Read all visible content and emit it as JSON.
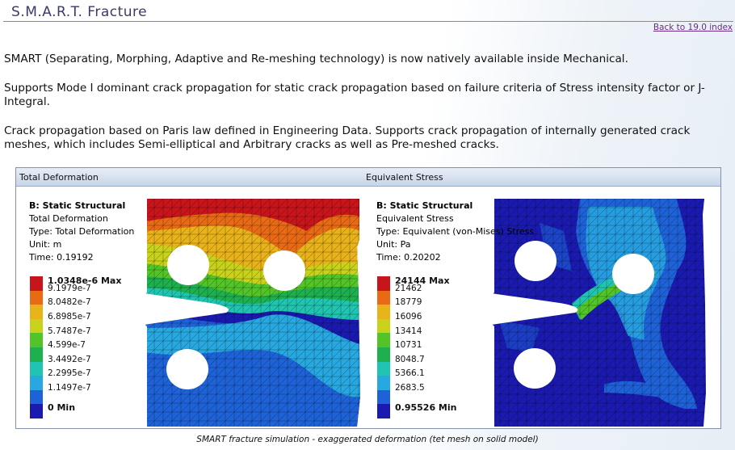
{
  "page": {
    "title": "S.M.A.R.T. Fracture",
    "back_link": "Back to 19.0 index"
  },
  "paragraphs": [
    "SMART (Separating, Morphing, Adaptive and Re-meshing technology) is now natively available inside Mechanical.",
    "Supports Mode I dominant crack propagation for static crack propagation based on failure criteria of Stress intensity factor or J-Integral.",
    "Crack propagation based on Paris law defined in Engineering Data. Supports crack propagation of internally generated crack meshes, which includes Semi-elliptical and Arbitrary cracks as well as Pre-meshed cracks."
  ],
  "figure": {
    "left_header": "Total Deformation",
    "right_header": "Equivalent Stress",
    "caption": "SMART fracture simulation - exaggerated deformation (tet mesh on solid model)",
    "left_info": {
      "analysis": "B: Static Structural",
      "result": "Total Deformation",
      "type": "Type: Total Deformation",
      "unit": "Unit: m",
      "time": "Time: 0.19192"
    },
    "right_info": {
      "analysis": "B: Static Structural",
      "result": "Equivalent Stress",
      "type": "Type: Equivalent (von-Mises) Stress",
      "unit": "Unit: Pa",
      "time": "Time: 0.20202"
    },
    "left_legend": [
      "1.0348e-6 Max",
      "9.1979e-7",
      "8.0482e-7",
      "6.8985e-7",
      "5.7487e-7",
      "4.599e-7",
      "3.4492e-7",
      "2.2995e-7",
      "1.1497e-7",
      "0 Min"
    ],
    "right_legend": [
      "24144 Max",
      "21462",
      "18779",
      "16096",
      "13414",
      "10731",
      "8048.7",
      "5366.1",
      "2683.5",
      "0.95526 Min"
    ],
    "legend_colors": [
      "#c8151b",
      "#e86a14",
      "#e8b21a",
      "#c8d21a",
      "#52c428",
      "#1eb04e",
      "#20c4b0",
      "#28a8e0",
      "#1e62d8",
      "#1a1ab0"
    ]
  }
}
